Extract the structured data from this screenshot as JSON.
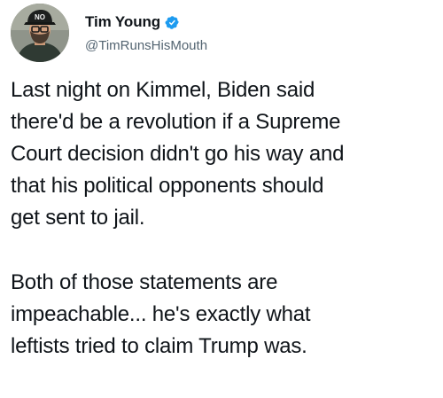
{
  "tweet": {
    "author": {
      "display_name": "Tim Young",
      "handle": "@TimRunsHisMouth",
      "verified": true,
      "avatar_icon": "profile-photo-man-in-cap",
      "avatar_cap_text": "NO"
    },
    "paragraphs": [
      "Last night on Kimmel, Biden said\nthere'd be a revolution if a Supreme\nCourt decision didn't go his way and\nthat his political opponents should\nget sent to jail.",
      "Both of those statements are\nimpeachable... he's exactly what\nleftists tried to claim Trump was."
    ]
  },
  "colors": {
    "text": "#0f1419",
    "secondary_text": "#536471",
    "verified_blue": "#1d9bf0",
    "background": "#ffffff"
  }
}
